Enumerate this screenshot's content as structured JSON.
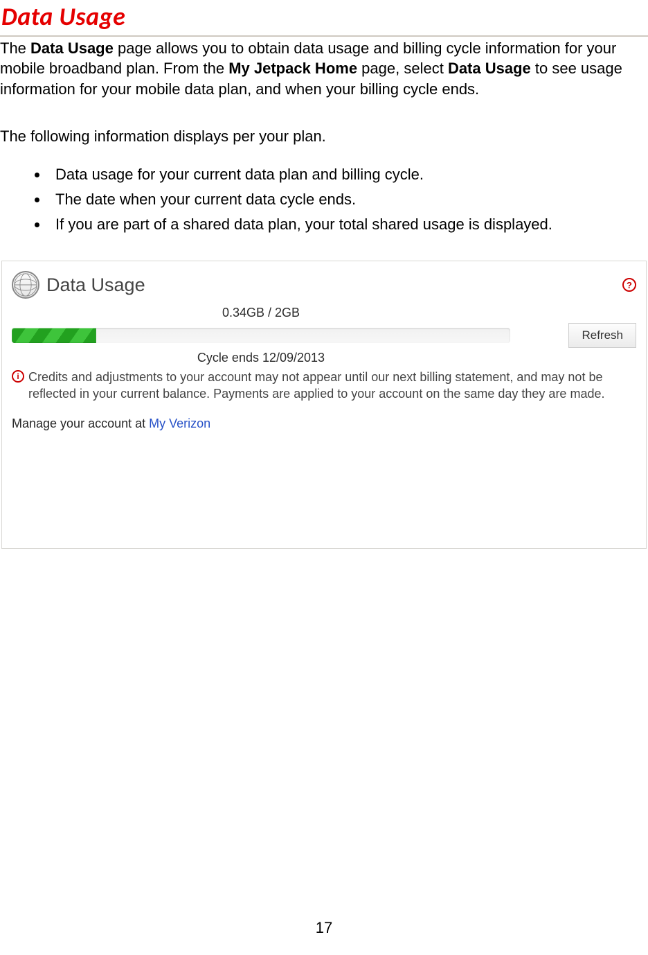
{
  "title": "Data Usage",
  "intro": {
    "parts": [
      {
        "text": "The "
      },
      {
        "text": "Data Usage",
        "bold": true
      },
      {
        "text": " page allows you to obtain data usage and billing cycle information for your mobile broadband plan. From the "
      },
      {
        "text": "My Jetpack Home",
        "bold": true
      },
      {
        "text": " page, select "
      },
      {
        "text": "Data Usage",
        "bold": true
      },
      {
        "text": " to see usage information for your mobile data plan, and when your billing cycle ends."
      }
    ]
  },
  "subhead": "The following information displays per your plan.",
  "bullets": [
    "Data usage for your current data plan and billing cycle.",
    "The date when your current data cycle ends.",
    "If you are part of a shared data plan, your total shared usage is displayed."
  ],
  "panel": {
    "title": "Data Usage",
    "usage_label": "0.34GB / 2GB",
    "progress_percent": 17,
    "cycle_text": "Cycle ends 12/09/2013",
    "refresh_label": "Refresh",
    "notice": "Credits and adjustments to your account may not appear until our next billing statement, and may not be reflected in your current balance. Payments are applied to your account on the same day they are made.",
    "manage_prefix": "Manage your account at ",
    "manage_link": "My Verizon"
  },
  "page_number": "17"
}
